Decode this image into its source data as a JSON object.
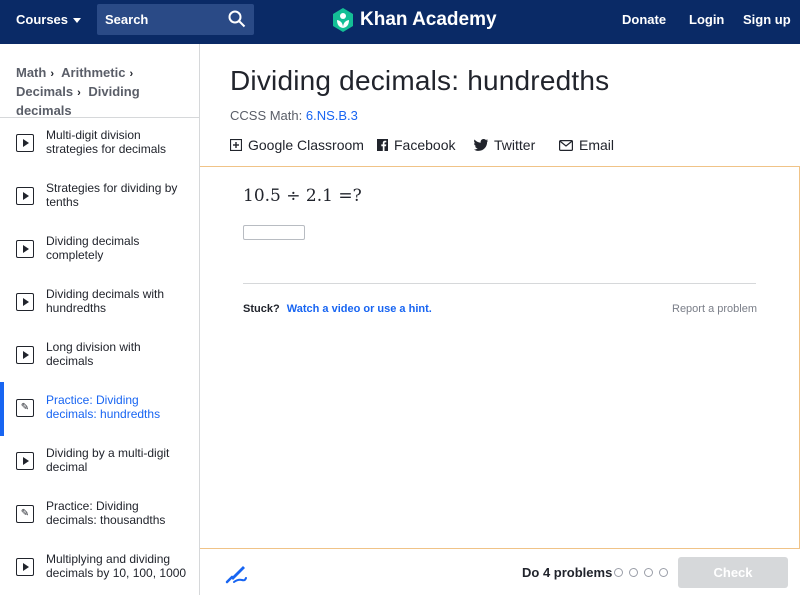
{
  "nav": {
    "courses_label": "Courses",
    "search_label": "Search",
    "brand": "Khan Academy",
    "donate": "Donate",
    "login": "Login",
    "signup": "Sign up"
  },
  "breadcrumb": [
    "Math",
    "Arithmetic",
    "Decimals",
    "Dividing decimals"
  ],
  "sidebar": {
    "items": [
      {
        "label": "Multi-digit division strategies for decimals",
        "icon": "video-icon",
        "active": false
      },
      {
        "label": "Strategies for dividing by tenths",
        "icon": "video-icon",
        "active": false
      },
      {
        "label": "Dividing decimals completely",
        "icon": "video-icon",
        "active": false
      },
      {
        "label": "Dividing decimals with hundredths",
        "icon": "video-icon",
        "active": false
      },
      {
        "label": "Long division with decimals",
        "icon": "video-icon",
        "active": false
      },
      {
        "label": "Practice: Dividing decimals: hundredths",
        "icon": "pencil-icon",
        "active": true
      },
      {
        "label": "Dividing by a multi-digit decimal",
        "icon": "video-icon",
        "active": false
      },
      {
        "label": "Practice: Dividing decimals: thousandths",
        "icon": "pencil-icon",
        "active": false
      },
      {
        "label": "Multiplying and dividing decimals by 10, 100, 1000",
        "icon": "video-icon",
        "active": false
      }
    ]
  },
  "main": {
    "title": "Dividing decimals: hundredths",
    "ccss_prefix": "CCSS Math:",
    "ccss_code": "6.NS.B.3",
    "share": {
      "google_classroom": "Google Classroom",
      "facebook": "Facebook",
      "twitter": "Twitter",
      "email": "Email"
    }
  },
  "exercise": {
    "problem": "10.5 ÷ 2.1 =?",
    "answer_value": "",
    "stuck_label": "Stuck?",
    "hint_link": "Watch a video or use a hint.",
    "report": "Report a problem"
  },
  "footer": {
    "do_problems": "Do 4 problems",
    "check_label": "Check",
    "progress_total": 4,
    "progress_done": 0
  },
  "colors": {
    "nav_bg": "#0a2a66",
    "accent": "#1865f2",
    "exercise_border": "#f0c387",
    "check_disabled": "#d6d8da"
  }
}
